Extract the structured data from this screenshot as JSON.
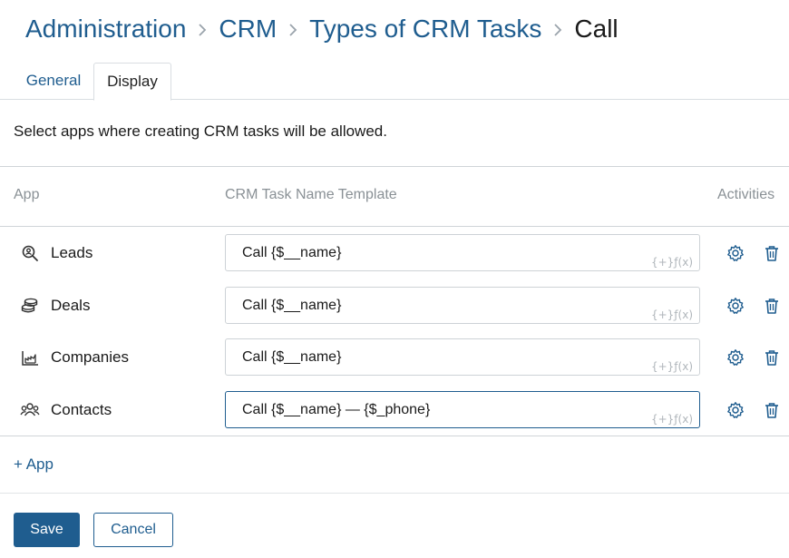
{
  "breadcrumb": {
    "items": [
      "Administration",
      "CRM",
      "Types of CRM Tasks"
    ],
    "current": "Call"
  },
  "tabs": [
    {
      "label": "General",
      "active": false
    },
    {
      "label": "Display",
      "active": true
    }
  ],
  "description": "Select apps where creating CRM tasks will be allowed.",
  "table": {
    "headers": {
      "app": "App",
      "template": "CRM Task Name Template",
      "activities": "Activities"
    },
    "rows": [
      {
        "app": "Leads",
        "icon": "leads-search-icon",
        "template": "Call {$__name}"
      },
      {
        "app": "Deals",
        "icon": "deals-coins-icon",
        "template": "Call {$__name}"
      },
      {
        "app": "Companies",
        "icon": "companies-chart-icon",
        "template": "Call {$__name}"
      },
      {
        "app": "Contacts",
        "icon": "contacts-people-icon",
        "template": "Call {$__name} — {$_phone}"
      }
    ],
    "field_hint": "{+}ƒ(x)"
  },
  "add_app_label": "+ App",
  "buttons": {
    "save": "Save",
    "cancel": "Cancel"
  },
  "colors": {
    "accent": "#1f5d8f",
    "text": "#1a1a1a",
    "muted": "#8a9196"
  }
}
